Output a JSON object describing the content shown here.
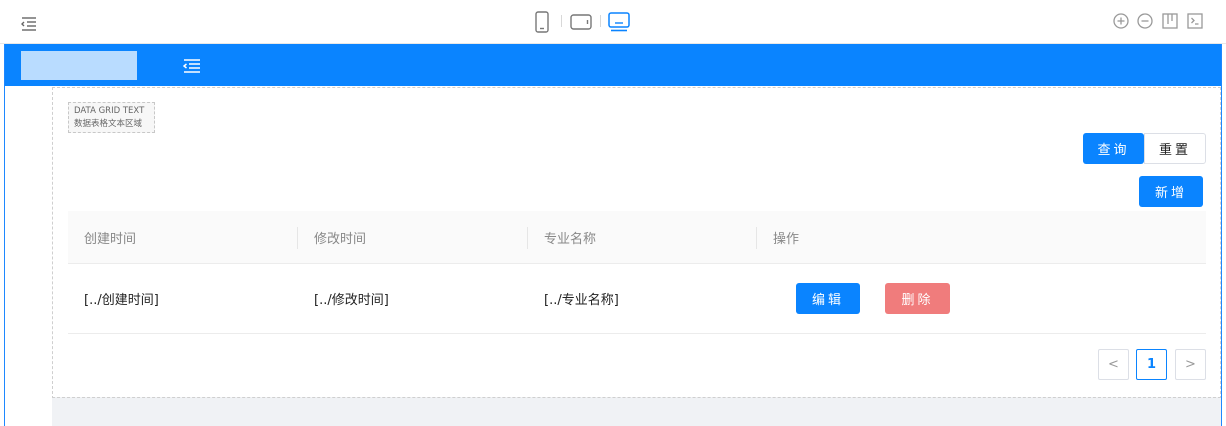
{
  "toolbar": {
    "menu_icon": "menu-indent-icon",
    "devices": [
      {
        "name": "phone",
        "icon": "phone-icon"
      },
      {
        "name": "tablet",
        "icon": "tablet-icon"
      },
      {
        "name": "desktop",
        "icon": "desktop-icon",
        "active": true
      }
    ],
    "tools": [
      "zoom-in-icon",
      "zoom-out-icon",
      "layout-icon",
      "console-icon"
    ]
  },
  "header": {
    "toggle_icon": "menu-fold-icon"
  },
  "grid_text": {
    "line1": "DATA GRID TEXT",
    "line2": "数据表格文本区域"
  },
  "actions": {
    "query_label": "查询",
    "reset_label": "重置",
    "add_label": "新增"
  },
  "table": {
    "columns": [
      "创建时间",
      "修改时间",
      "专业名称",
      "操作"
    ],
    "rows": [
      {
        "created": "[../创建时间]",
        "modified": "[../修改时间]",
        "major": "[../专业名称]",
        "edit_label": "编辑",
        "delete_label": "删除"
      }
    ]
  },
  "pagination": {
    "prev": "<",
    "current": "1",
    "next": ">"
  },
  "colors": {
    "primary": "#0a84ff",
    "danger": "#f07c7c",
    "logo_placeholder": "#b9dcff"
  }
}
